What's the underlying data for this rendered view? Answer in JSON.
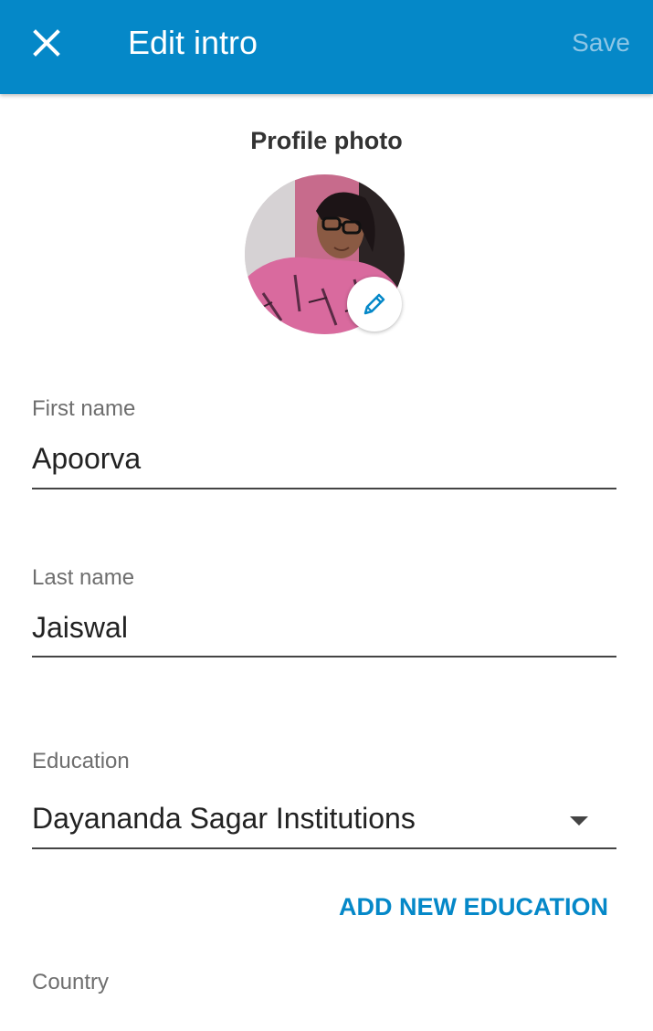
{
  "header": {
    "title": "Edit intro",
    "save_label": "Save"
  },
  "photo": {
    "label": "Profile photo"
  },
  "fields": {
    "first_name": {
      "label": "First name",
      "value": "Apoorva"
    },
    "last_name": {
      "label": "Last name",
      "value": "Jaiswal"
    },
    "education": {
      "label": "Education",
      "value": "Dayananda Sagar Institutions"
    },
    "country": {
      "label": "Country"
    }
  },
  "actions": {
    "add_education": "ADD NEW EDUCATION"
  },
  "colors": {
    "accent": "#0588C8",
    "save_disabled": "#8DC6E6"
  },
  "icons": {
    "close": "close-icon",
    "edit_photo": "pencil-icon",
    "dropdown": "chevron-down-icon"
  }
}
